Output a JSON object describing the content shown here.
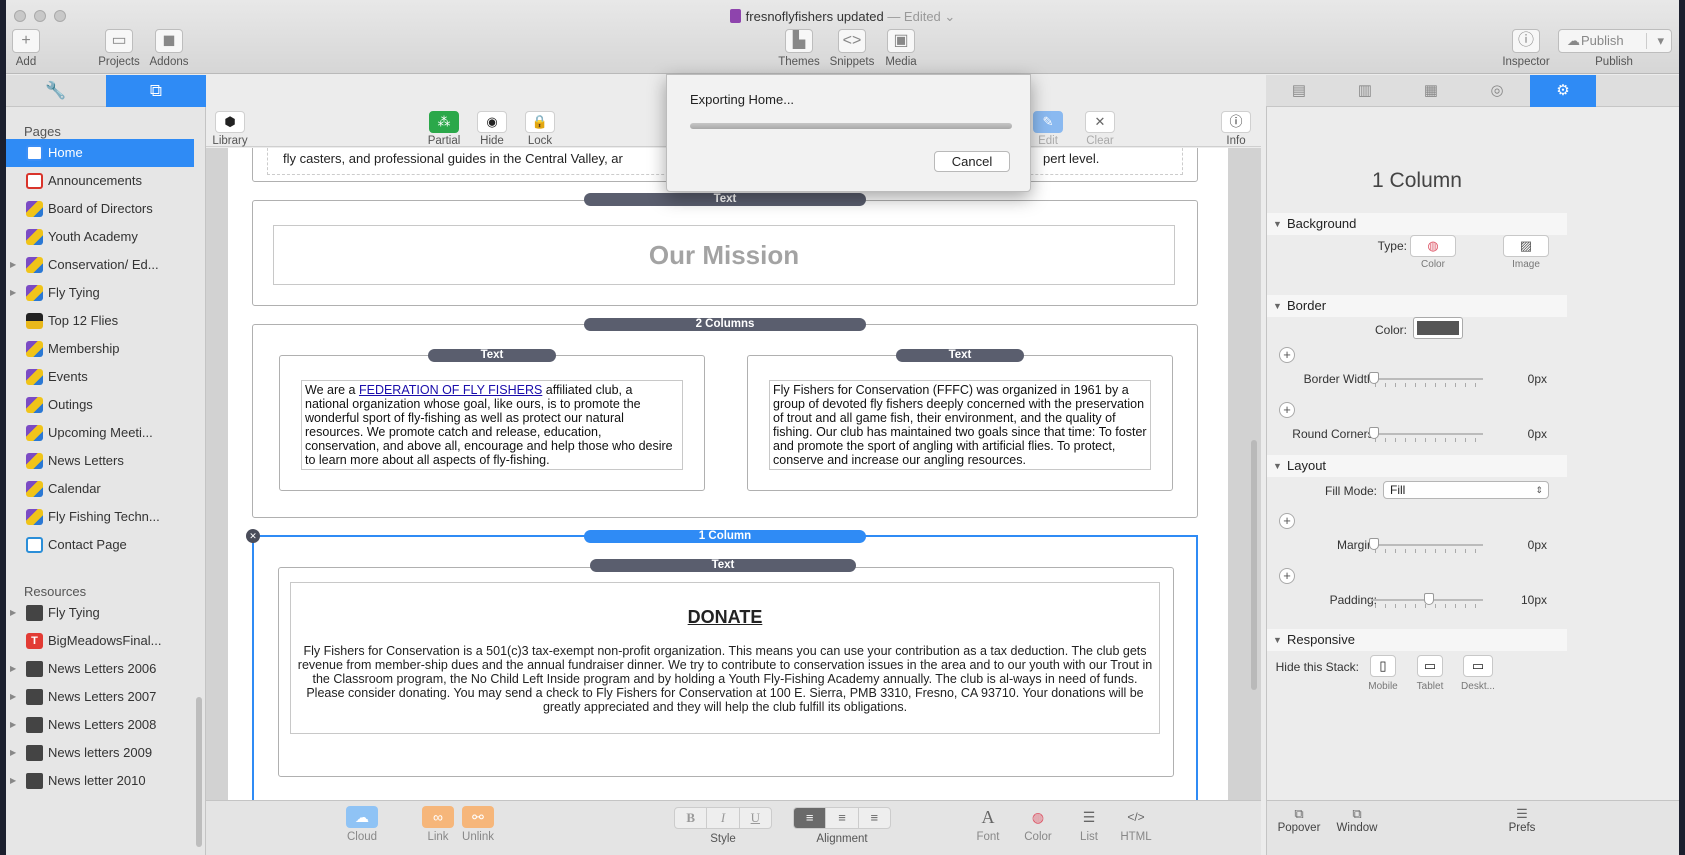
{
  "window": {
    "title": "fresnoflyfishers updated",
    "status": "— Edited",
    "status_arrow": "⌄"
  },
  "toolbar": {
    "add": {
      "label": "Add",
      "icon": "+"
    },
    "projects": {
      "label": "Projects",
      "icon": "▭"
    },
    "addons": {
      "label": "Addons",
      "icon": "◼"
    },
    "themes": {
      "label": "Themes",
      "icon": "▙"
    },
    "snippets": {
      "label": "Snippets",
      "icon": "<>"
    },
    "media": {
      "label": "Media",
      "icon": "▣"
    },
    "inspector": {
      "label": "Inspector",
      "icon": "ⓘ"
    },
    "publish": {
      "label": "Publish",
      "button": "Publish",
      "icon": "☁",
      "arrow": "▾"
    }
  },
  "left_tabs": {
    "tab1_icon": "🔧",
    "tab2_icon": "⧉"
  },
  "sidebar": {
    "pages_header": "Pages",
    "pages": [
      {
        "label": "Home",
        "icon": "home",
        "selected": true,
        "expandable": false
      },
      {
        "label": "Announcements",
        "icon": "ann",
        "expandable": false
      },
      {
        "label": "Board of Directors",
        "icon": "stack",
        "expandable": false
      },
      {
        "label": "Youth Academy",
        "icon": "stack",
        "expandable": false
      },
      {
        "label": "Conservation/ Ed...",
        "icon": "stack",
        "expandable": true
      },
      {
        "label": "Fly Tying",
        "icon": "stack",
        "expandable": true
      },
      {
        "label": "Top 12 Flies",
        "icon": "flies",
        "expandable": false
      },
      {
        "label": "Membership",
        "icon": "stack",
        "expandable": false
      },
      {
        "label": "Events",
        "icon": "stack",
        "expandable": false
      },
      {
        "label": "Outings",
        "icon": "stack",
        "expandable": false
      },
      {
        "label": "Upcoming Meeti...",
        "icon": "stack",
        "expandable": false
      },
      {
        "label": "News Letters",
        "icon": "stack",
        "expandable": false
      },
      {
        "label": "Calendar",
        "icon": "stack",
        "expandable": false
      },
      {
        "label": "Fly Fishing Techn...",
        "icon": "stack",
        "expandable": false
      },
      {
        "label": "Contact Page",
        "icon": "mail",
        "expandable": false
      }
    ],
    "resources_header": "Resources",
    "resources": [
      {
        "label": "Fly Tying",
        "icon": "folder",
        "expandable": true
      },
      {
        "label": "BigMeadowsFinal...",
        "icon": "t",
        "expandable": false
      },
      {
        "label": "News Letters 2006",
        "icon": "folder",
        "expandable": true
      },
      {
        "label": "News Letters 2007",
        "icon": "folder",
        "expandable": true
      },
      {
        "label": "News Letters 2008",
        "icon": "folder",
        "expandable": true
      },
      {
        "label": "News letters 2009",
        "icon": "folder",
        "expandable": true
      },
      {
        "label": "News letter 2010",
        "icon": "folder",
        "expandable": true
      }
    ]
  },
  "edit_toolbar": {
    "library": {
      "label": "Library",
      "icon": "⬢"
    },
    "partial": {
      "label": "Partial",
      "icon": "⁂"
    },
    "hide": {
      "label": "Hide",
      "icon": "◉"
    },
    "lock": {
      "label": "Lock",
      "icon": "🔒"
    },
    "edit": {
      "label": "Edit",
      "icon": "✎"
    },
    "clear": {
      "label": "Clear",
      "icon": "✕"
    },
    "info": {
      "label": "Info",
      "icon": "ⓘ"
    }
  },
  "canvas": {
    "top_text_left": "fly casters, and professional guides in the Central Valley, ar",
    "top_text_right": "pert level.",
    "mission_stack_label": "Text",
    "mission_heading": "Our Mission",
    "two_col_label": "2 Columns",
    "col1_label": "Text",
    "col1_pre": "We are a ",
    "col1_link": "FEDERATION OF FLY FISHERS",
    "col1_post": " affiliated club, a national organization whose goal, like ours, is to promote the wonderful sport of fly-fishing as well as protect our natural resources. We promote catch and release, education, conservation, and above all, encourage and help those who desire to learn more about all aspects of fly-fishing.",
    "col2_label": "Text",
    "col2_text": "Fly Fishers for Conservation (FFFC) was organized in 1961 by a group of devoted fly fishers deeply concerned with the preservation of trout and all game fish, their environment, and the quality of fishing. Our club has maintained two goals since that time: To foster and promote the sport of angling with artificial flies. To protect, conserve and increase our angling resources.",
    "one_col_label": "1 Column",
    "one_col_remove": "✕",
    "donate_label": "Text",
    "donate_heading": "DONATE",
    "donate_text": "Fly Fishers for Conservation is a 501(c)3 tax-exempt non-profit organization. This means you can use your contribution as a tax deduction. The club gets revenue from member-ship dues and the annual fundraiser dinner. We try to contribute to conservation issues in the area and to our youth with our Trout in the Classroom program, the No Child Left Inside program and by holding a Youth Fly-Fishing Academy annually. The club is al-ways in need of funds. Please consider donating. You may send a check to Fly Fishers for Conservation at 100 E. Sierra, PMB 3310, Fresno, CA 93710. Your donations will be greatly appreciated and they will help the club fulfill its obligations."
  },
  "bottom_toolbar": {
    "cloud": {
      "label": "Cloud",
      "icon": "☁"
    },
    "link": {
      "label": "Link",
      "icon": "∞"
    },
    "unlink": {
      "label": "Unlink",
      "icon": "⚯"
    },
    "style": {
      "label": "Style",
      "bold": "B",
      "italic": "I",
      "underline": "U"
    },
    "alignment": {
      "label": "Alignment",
      "left": "≡",
      "center": "≡",
      "right": "≡"
    },
    "font": {
      "label": "Font",
      "icon": "A"
    },
    "color": {
      "label": "Color",
      "icon": "◍"
    },
    "list": {
      "label": "List",
      "icon": "☰"
    },
    "html": {
      "label": "HTML",
      "icon": "</>"
    }
  },
  "inspector": {
    "tab_icons": [
      "▤",
      "▥",
      "▦",
      "◎",
      "⚙"
    ],
    "title": "1 Column",
    "background": {
      "header": "Background",
      "type_label": "Type:",
      "color_caption": "Color",
      "image_caption": "Image",
      "color_icon": "◍",
      "image_icon": "▨"
    },
    "border": {
      "header": "Border",
      "color_label": "Color:",
      "swatch": "#555555",
      "width_label": "Border Width:",
      "width_value": "0px",
      "corners_label": "Round Corners:",
      "corners_value": "0px"
    },
    "layout": {
      "header": "Layout",
      "fill_label": "Fill Mode:",
      "fill_value": "Fill",
      "margin_label": "Margin:",
      "margin_value": "0px",
      "padding_label": "Padding:",
      "padding_value": "10px"
    },
    "responsive": {
      "header": "Responsive",
      "hide_label": "Hide this Stack:",
      "mobile": "Mobile",
      "tablet": "Tablet",
      "desktop": "Deskt..."
    },
    "plus": "+",
    "bottom": {
      "popover": "Popover",
      "window": "Window",
      "prefs": "Prefs"
    }
  },
  "dialog": {
    "message": "Exporting Home...",
    "progress": 0.0,
    "cancel": "Cancel"
  },
  "colors": {
    "accent": "#2f8bf5",
    "stack_label": "#5a5e6e",
    "partial_green": "#2ba84a",
    "link_orange": "#f6b67a",
    "cloud_blue": "#8fc3f5"
  }
}
